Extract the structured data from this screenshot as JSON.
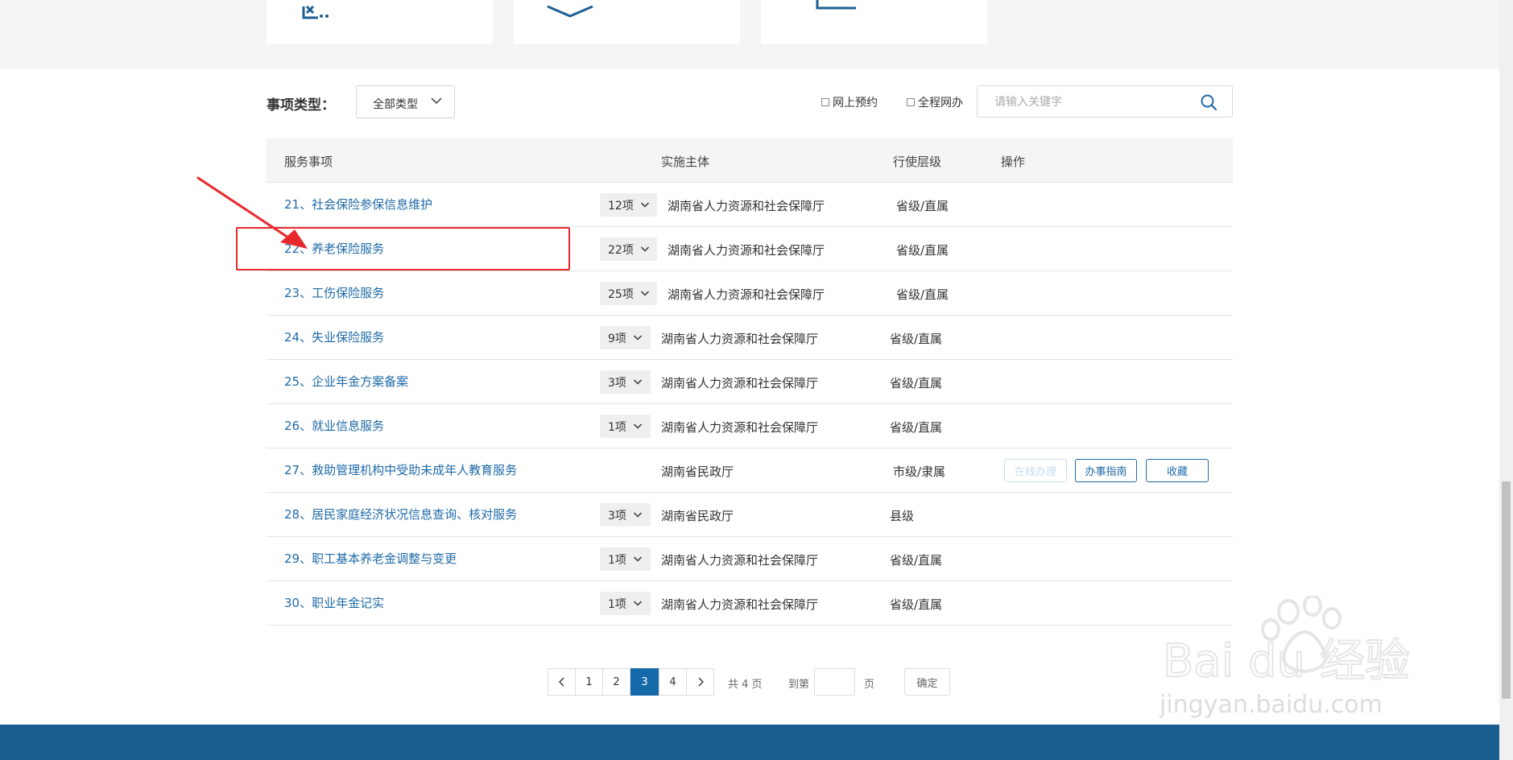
{
  "filter": {
    "type_label": "事项类型：",
    "type_value": "全部类型",
    "online_booking": "网上预约",
    "full_online": "全程网办",
    "search_placeholder": "请输入关键字"
  },
  "table": {
    "headers": {
      "service": "服务事项",
      "agency": "实施主体",
      "level": "行使层级",
      "ops": "操作"
    },
    "rows": [
      {
        "title": "21、社会保险参保信息维护",
        "count": "12项",
        "agency": "湖南省人力资源和社会保障厅",
        "level": "省级/直属"
      },
      {
        "title": "22、养老保险服务",
        "count": "22项",
        "agency": "湖南省人力资源和社会保障厅",
        "level": "省级/直属"
      },
      {
        "title": "23、工伤保险服务",
        "count": "25项",
        "agency": "湖南省人力资源和社会保障厅",
        "level": "省级/直属"
      },
      {
        "title": "24、失业保险服务",
        "count": "9项",
        "agency": "湖南省人力资源和社会保障厅",
        "level": "省级/直属"
      },
      {
        "title": "25、企业年金方案备案",
        "count": "3项",
        "agency": "湖南省人力资源和社会保障厅",
        "level": "省级/直属"
      },
      {
        "title": "26、就业信息服务",
        "count": "1项",
        "agency": "湖南省人力资源和社会保障厅",
        "level": "省级/直属"
      },
      {
        "title": "27、救助管理机构中受助未成年人教育服务",
        "count": "",
        "agency": "湖南省民政厅",
        "level": "市级/隶属",
        "ops": [
          "在线办理",
          "办事指南",
          "收藏"
        ]
      },
      {
        "title": "28、居民家庭经济状况信息查询、核对服务",
        "count": "3项",
        "agency": "湖南省民政厅",
        "level": "县级"
      },
      {
        "title": "29、职工基本养老金调整与变更",
        "count": "1项",
        "agency": "湖南省人力资源和社会保障厅",
        "level": "省级/直属"
      },
      {
        "title": "30、职业年金记实",
        "count": "1项",
        "agency": "湖南省人力资源和社会保障厅",
        "level": "省级/直属"
      }
    ]
  },
  "pagination": {
    "pages": [
      "1",
      "2",
      "3",
      "4"
    ],
    "current": "3",
    "total_text": "共 4 页",
    "goto_label": "到第",
    "page_suffix": "页",
    "confirm": "确定"
  },
  "watermark": {
    "text": "jingyan.baidu.com",
    "logo": "Bai du 经验"
  },
  "colors": {
    "link": "#1e6aa8",
    "active_page": "#1569a8",
    "annotation": "#e8282d",
    "footer": "#1a5d91"
  }
}
